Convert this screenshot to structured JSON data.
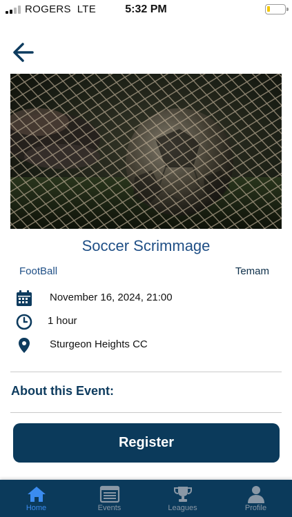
{
  "status_bar": {
    "carrier": "ROGERS",
    "network": "LTE",
    "time": "5:32 PM",
    "battery_level": 0.15,
    "battery_color": "#f3c600"
  },
  "header": {
    "back_icon": "arrow-left-icon"
  },
  "event": {
    "title": "Soccer Scrimmage",
    "sport": "FootBall",
    "team": "Temam",
    "date": "November 16, 2024, 21:00",
    "duration": "1 hour",
    "location": "Sturgeon Heights CC",
    "about_heading": "About this Event:"
  },
  "actions": {
    "register_label": "Register"
  },
  "tab_bar": {
    "active": "Home",
    "tabs": [
      {
        "label": "Home",
        "icon": "home-icon"
      },
      {
        "label": "Events",
        "icon": "events-icon"
      },
      {
        "label": "Leagues",
        "icon": "trophy-icon"
      },
      {
        "label": "Profile",
        "icon": "person-icon"
      }
    ]
  },
  "colors": {
    "primary": "#0b3a5b",
    "title": "#1f4f86",
    "active_tab": "#3b8cf0",
    "inactive_tab": "#8a98a6"
  }
}
